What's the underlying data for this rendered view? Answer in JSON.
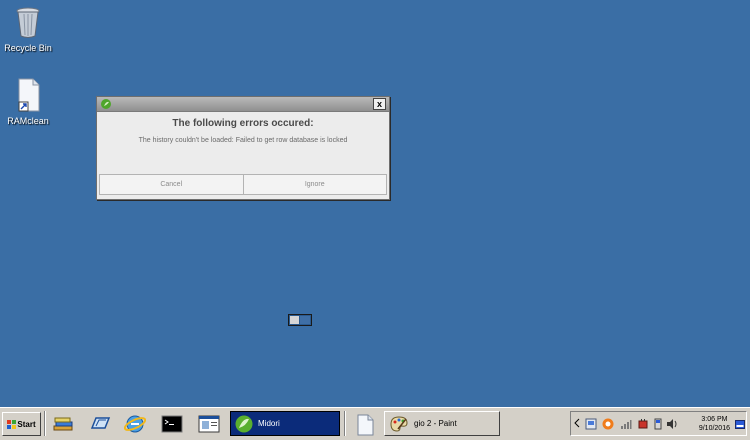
{
  "desktop": {
    "icons": [
      {
        "label": "Recycle Bin"
      },
      {
        "label": "RAMclean"
      }
    ]
  },
  "dialog": {
    "heading": "The following errors occured:",
    "message": "The history couldn't be loaded: Failed to get row database is locked",
    "close_label": "x",
    "buttons": {
      "cancel": "Cancel",
      "ignore": "Ignore"
    }
  },
  "taskbar": {
    "start_label": "Start",
    "tasks": [
      {
        "label": "Midori",
        "active": true
      },
      {
        "label": "gio 2 - Paint",
        "active": false
      }
    ],
    "clock": {
      "time": "3:06 PM",
      "date": "9/10/2016"
    }
  }
}
